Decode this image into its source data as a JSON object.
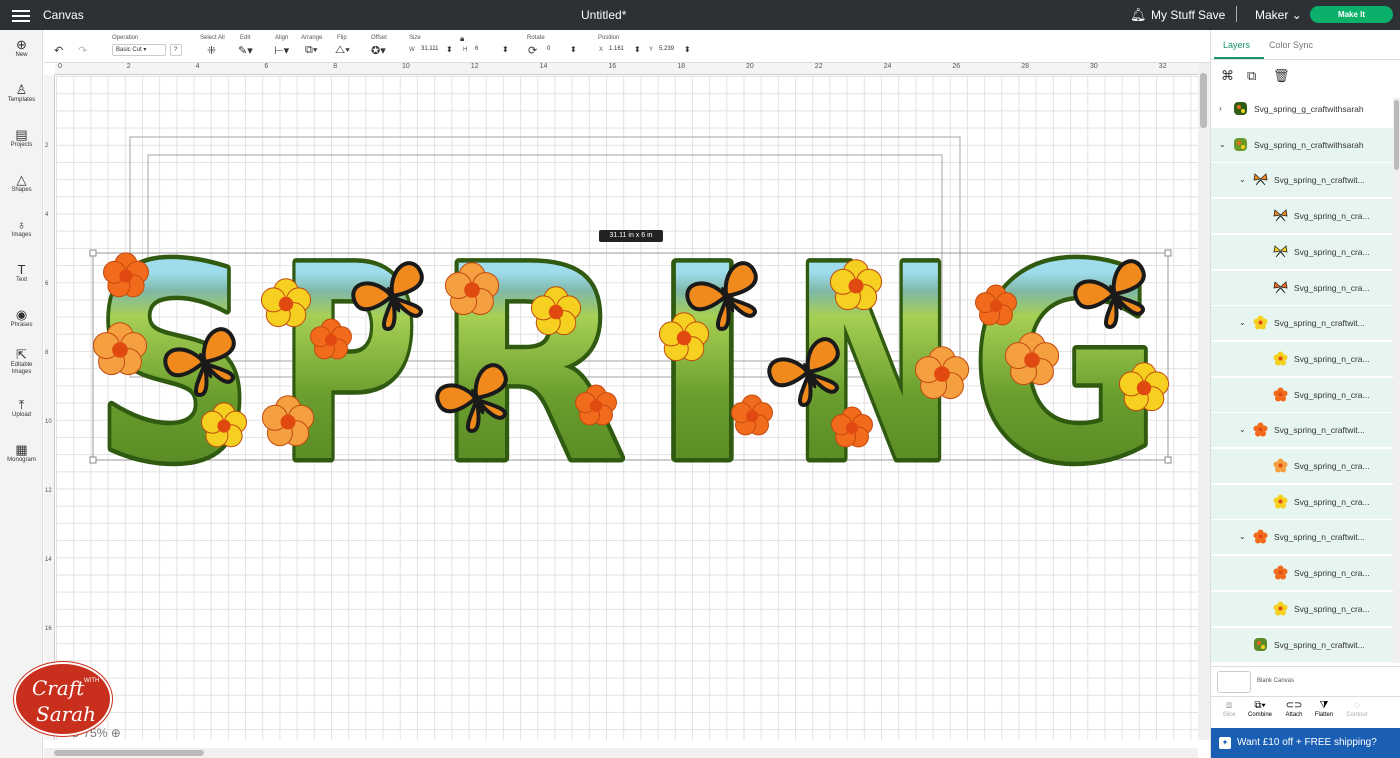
{
  "topbar": {
    "app_title": "Canvas",
    "document_title": "Untitled*",
    "my_stuff": "My Stuff",
    "save": "Save",
    "machine": "Maker",
    "make_it": "Make It"
  },
  "left_tools": [
    {
      "label": "New",
      "icon": "plus-icon"
    },
    {
      "label": "Templates",
      "icon": "shirt-icon"
    },
    {
      "label": "Projects",
      "icon": "projects-icon"
    },
    {
      "label": "Shapes",
      "icon": "shapes-icon"
    },
    {
      "label": "Images",
      "icon": "lightbulb-icon"
    },
    {
      "label": "Text",
      "icon": "text-icon"
    },
    {
      "label": "Phrases",
      "icon": "phrases-icon"
    },
    {
      "label": "Editable Images",
      "icon": "editable-images-icon"
    },
    {
      "label": "Upload",
      "icon": "upload-icon"
    },
    {
      "label": "Monogram",
      "icon": "monogram-icon"
    }
  ],
  "toolbar": {
    "operation_label": "Operation",
    "operation_value": "Basic Cut",
    "select_all": "Select All",
    "edit": "Edit",
    "align": "Align",
    "arrange": "Arrange",
    "flip": "Flip",
    "offset": "Offset",
    "size_label": "Size",
    "w_label": "W",
    "w_value": "31.111",
    "h_label": "H",
    "h_value": "6",
    "rotate_label": "Rotate",
    "rotate_value": "0",
    "position_label": "Position",
    "x_label": "X",
    "x_value": "1.161",
    "y_label": "Y",
    "y_value": "5.239"
  },
  "ruler": {
    "top": [
      "0",
      "2",
      "4",
      "6",
      "8",
      "10",
      "12",
      "14",
      "16",
      "18",
      "20",
      "22",
      "24",
      "26",
      "28",
      "30",
      "32"
    ],
    "left": [
      "2",
      "4",
      "6",
      "8",
      "10",
      "12",
      "14",
      "16"
    ]
  },
  "canvas": {
    "dimension_tooltip": "31.11  in x 6  in",
    "zoom": "75%",
    "artwork_text": "SPRING"
  },
  "panel": {
    "tab_layers": "Layers",
    "tab_color_sync": "Color Sync",
    "layers": [
      {
        "name": "Svg_spring_g_craftwithsarah",
        "level": 0,
        "chevron": "›"
      },
      {
        "name": "Svg_spring_n_craftwithsarah",
        "level": 0,
        "chevron": "⌄"
      },
      {
        "name": "Svg_spring_n_craftwit...",
        "level": 1,
        "chevron": "⌄"
      },
      {
        "name": "Svg_spring_n_cra...",
        "level": 2,
        "chevron": ""
      },
      {
        "name": "Svg_spring_n_cra...",
        "level": 2,
        "chevron": ""
      },
      {
        "name": "Svg_spring_n_cra...",
        "level": 2,
        "chevron": ""
      },
      {
        "name": "Svg_spring_n_craftwit...",
        "level": 1,
        "chevron": "⌄"
      },
      {
        "name": "Svg_spring_n_cra...",
        "level": 2,
        "chevron": ""
      },
      {
        "name": "Svg_spring_n_cra...",
        "level": 2,
        "chevron": ""
      },
      {
        "name": "Svg_spring_n_craftwit...",
        "level": 1,
        "chevron": "⌄"
      },
      {
        "name": "Svg_spring_n_cra...",
        "level": 2,
        "chevron": ""
      },
      {
        "name": "Svg_spring_n_cra...",
        "level": 2,
        "chevron": ""
      },
      {
        "name": "Svg_spring_n_craftwit...",
        "level": 1,
        "chevron": "⌄"
      },
      {
        "name": "Svg_spring_n_cra...",
        "level": 2,
        "chevron": ""
      },
      {
        "name": "Svg_spring_n_cra...",
        "level": 2,
        "chevron": ""
      },
      {
        "name": "Svg_spring_n_craftwit...",
        "level": 1,
        "chevron": ""
      }
    ],
    "blank_canvas": "Blank Canvas",
    "ops": [
      "Slice",
      "Combine",
      "Attach",
      "Flatten",
      "Contour"
    ],
    "promo": "Want £10 off + FREE shipping?"
  },
  "logo": {
    "line1": "Craft",
    "with": "WITH",
    "line2": "Sarah"
  },
  "colors": {
    "accent": "#0bb06a",
    "topbar": "#2d3035",
    "promo": "#1a5fb4",
    "logo": "#c8301d"
  }
}
